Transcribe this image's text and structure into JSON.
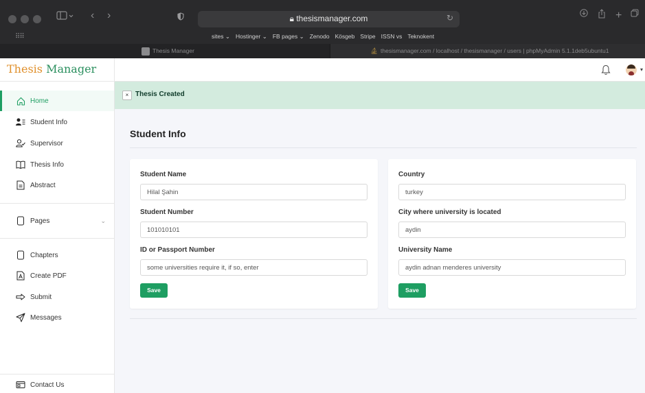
{
  "browser": {
    "url": "thesismanager.com",
    "favorites": [
      "sites ⌄",
      "Hostinger ⌄",
      "FB pages ⌄",
      "Zenodo",
      "Kösgeb",
      "Stripe",
      "ISSN vs",
      "Teknokent"
    ],
    "tabs": [
      {
        "label": "Thesis Manager"
      },
      {
        "label": "thesismanager.com / localhost / thesismanager / users | phpMyAdmin 5.1.1deb5ubuntu1"
      }
    ]
  },
  "brand": {
    "part1": "Thesis",
    "part2": " Manager"
  },
  "sidebar": {
    "items": [
      {
        "label": "Home",
        "icon": "home-icon"
      },
      {
        "label": "Student Info",
        "icon": "student-icon"
      },
      {
        "label": "Supervisor",
        "icon": "supervisor-icon"
      },
      {
        "label": "Thesis Info",
        "icon": "book-icon"
      },
      {
        "label": "Abstract",
        "icon": "document-icon"
      },
      {
        "label": "Pages",
        "icon": "pages-icon"
      },
      {
        "label": "Chapters",
        "icon": "chapters-icon"
      },
      {
        "label": "Create PDF",
        "icon": "pdf-icon"
      },
      {
        "label": "Submit",
        "icon": "arrow-right-icon"
      },
      {
        "label": "Messages",
        "icon": "send-icon"
      },
      {
        "label": "Contact Us",
        "icon": "contact-card-icon"
      }
    ]
  },
  "alert": {
    "close": "×",
    "text": "Thesis Created"
  },
  "page": {
    "title": "Student Info"
  },
  "form_left": {
    "student_name_label": "Student Name",
    "student_name_value": "Hilal Şahin",
    "student_number_label": "Student Number",
    "student_number_value": "101010101",
    "id_label": "ID or Passport Number",
    "id_placeholder": "some universities require it, if so, enter",
    "save": "Save"
  },
  "form_right": {
    "country_label": "Country",
    "country_value": "turkey",
    "city_label": "City where university is located",
    "city_value": "aydin",
    "university_label": "University Name",
    "university_value": "aydin adnan menderes university",
    "save": "Save"
  },
  "colors": {
    "accent": "#1e9e62",
    "alert_bg": "#d3ebde",
    "brand_orange": "#e0902c"
  }
}
